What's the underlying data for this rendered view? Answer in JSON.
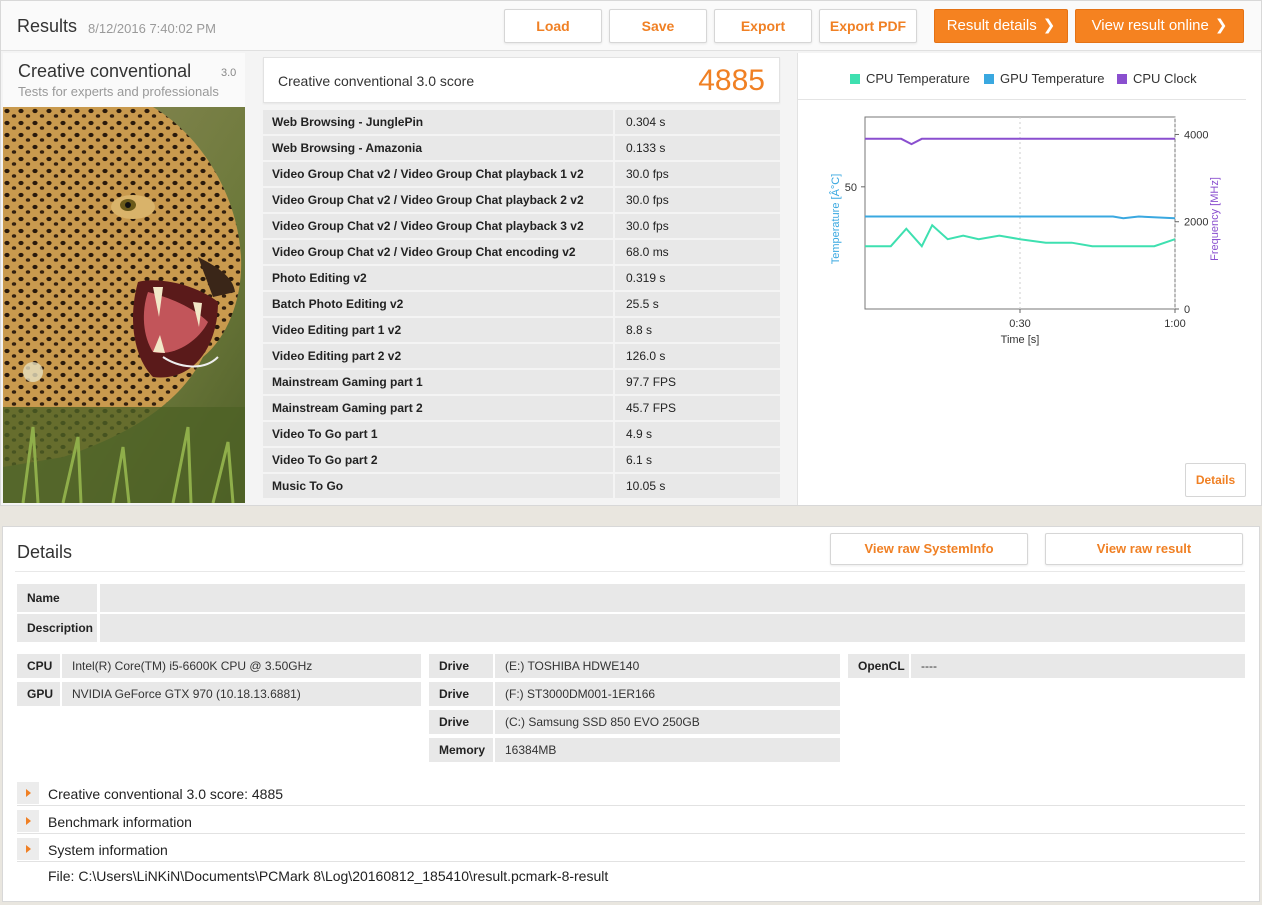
{
  "header": {
    "title": "Results",
    "date": "8/12/2016 7:40:02 PM",
    "buttons": {
      "load": "Load",
      "save": "Save",
      "export": "Export",
      "export_pdf": "Export PDF",
      "result_details": "Result details",
      "view_online": "View result online"
    },
    "chevron": "❯"
  },
  "benchmark": {
    "name": "Creative conventional",
    "version": "3.0",
    "subtitle": "Tests for experts and professionals"
  },
  "score": {
    "label": "Creative conventional 3.0 score",
    "value": "4885"
  },
  "results": [
    {
      "name": "Web Browsing - JunglePin",
      "value": "0.304 s"
    },
    {
      "name": "Web Browsing - Amazonia",
      "value": "0.133 s"
    },
    {
      "name": "Video Group Chat v2 / Video Group Chat playback 1 v2",
      "value": "30.0 fps"
    },
    {
      "name": "Video Group Chat v2 / Video Group Chat playback 2 v2",
      "value": "30.0 fps"
    },
    {
      "name": "Video Group Chat v2 / Video Group Chat playback 3 v2",
      "value": "30.0 fps"
    },
    {
      "name": "Video Group Chat v2 / Video Group Chat encoding v2",
      "value": "68.0 ms"
    },
    {
      "name": "Photo Editing v2",
      "value": "0.319 s"
    },
    {
      "name": "Batch Photo Editing v2",
      "value": "25.5 s"
    },
    {
      "name": "Video Editing part 1 v2",
      "value": "8.8 s"
    },
    {
      "name": "Video Editing part 2 v2",
      "value": "126.0 s"
    },
    {
      "name": "Mainstream Gaming part 1",
      "value": "97.7 FPS"
    },
    {
      "name": "Mainstream Gaming part 2",
      "value": "45.7 FPS"
    },
    {
      "name": "Video To Go part 1",
      "value": "4.9 s"
    },
    {
      "name": "Video To Go part 2",
      "value": "6.1 s"
    },
    {
      "name": "Music To Go",
      "value": "10.05 s"
    }
  ],
  "chart_data": {
    "type": "line",
    "series": [
      {
        "name": "CPU Temperature",
        "color": "#3ee0b0",
        "axis": "left",
        "x": [
          0,
          5,
          8,
          11,
          13,
          16,
          19,
          22,
          26,
          30,
          35,
          40,
          44,
          48,
          52,
          56,
          60
        ],
        "values": [
          33,
          33,
          38,
          33,
          39,
          35,
          36,
          35,
          36,
          35,
          34,
          34,
          33,
          33,
          33,
          33,
          35
        ]
      },
      {
        "name": "GPU Temperature",
        "color": "#3aa8e0",
        "axis": "left",
        "x": [
          0,
          10,
          20,
          30,
          40,
          48,
          50,
          53,
          60
        ],
        "values": [
          41.5,
          41.5,
          41.5,
          41.5,
          41.5,
          41.5,
          41,
          41.5,
          41
        ]
      },
      {
        "name": "CPU Clock",
        "color": "#8a4fcf",
        "axis": "right",
        "x": [
          0,
          7,
          9,
          11,
          20,
          30,
          40,
          50,
          60
        ],
        "values": [
          3900,
          3900,
          3780,
          3900,
          3900,
          3900,
          3900,
          3900,
          3900
        ]
      }
    ],
    "xlabel": "Time [s]",
    "xlim": [
      0,
      60
    ],
    "xticks": [
      {
        "value": 30,
        "label": "0:30"
      },
      {
        "value": 60,
        "label": "1:00"
      }
    ],
    "ylabel_left": "Temperature [Â°C]",
    "ylim_left": [
      15,
      70
    ],
    "yticks_left": [
      50
    ],
    "ylabel_right": "Frequency [MHz]",
    "ylim_right": [
      0,
      4400
    ],
    "yticks_right": [
      0,
      2000,
      4000
    ],
    "grid": true,
    "legend_position": "top"
  },
  "chart_details_button": "Details",
  "details": {
    "title": "Details",
    "view_raw_systeminfo": "View raw SystemInfo",
    "view_raw_result": "View raw result",
    "name_key": "Name",
    "name_value": "",
    "description_key": "Description",
    "description_value": "",
    "cpu_key": "CPU",
    "cpu_value": "Intel(R) Core(TM) i5-6600K CPU @ 3.50GHz",
    "gpu_key": "GPU",
    "gpu_value": "NVIDIA GeForce GTX 970 (10.18.13.6881)",
    "drives": [
      {
        "key": "Drive",
        "value": "(E:) TOSHIBA HDWE140"
      },
      {
        "key": "Drive",
        "value": "(F:) ST3000DM001-1ER166"
      },
      {
        "key": "Drive",
        "value": "(C:) Samsung SSD 850 EVO 250GB"
      }
    ],
    "memory_key": "Memory",
    "memory_value": "16384MB",
    "opencl_key": "OpenCL",
    "opencl_value": "----",
    "expanders": [
      "Creative conventional 3.0 score: 4885",
      "Benchmark information",
      "System information"
    ],
    "file_path": "File: C:\\Users\\LiNKiN\\Documents\\PCMark 8\\Log\\20160812_185410\\result.pcmark-8-result"
  }
}
